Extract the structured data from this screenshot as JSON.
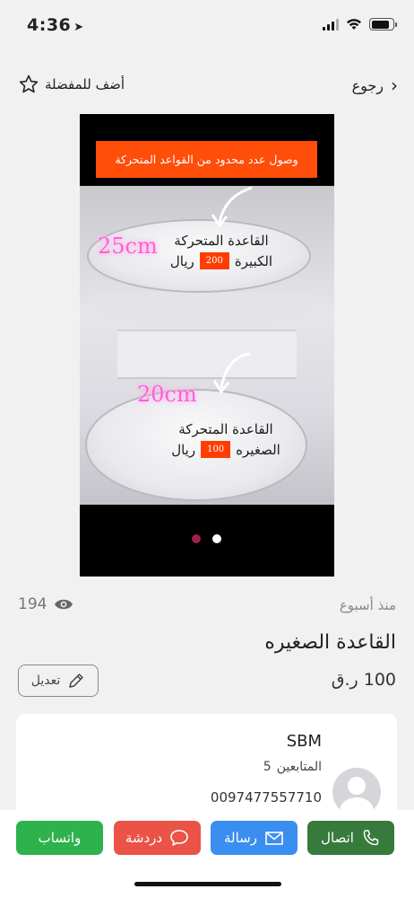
{
  "status_bar": {
    "time": "4:36",
    "location_arrow": "➤",
    "battery_level_percent": 85
  },
  "nav": {
    "back_label": "رجوع",
    "back_chevron": "‹",
    "favorite_label": "أضف للمفضلة"
  },
  "media": {
    "banner_text": "وصول عدد محدود من القواعد المتحركة",
    "big_size": "25cm",
    "big_title": "القاعدة المتحركة",
    "big_prefix": "الكبيرة",
    "big_price": "200",
    "big_currency": "ريال",
    "small_size": "20cm",
    "small_title": "القاعدة المتحركة",
    "small_prefix": "الصغيره",
    "small_price": "100",
    "small_currency": "ريال",
    "active_slide": 1,
    "slide_count": 2,
    "colors": {
      "dot_active": "#a0204f",
      "dot_inactive": "#ffffff",
      "banner": "#ff4d0a"
    }
  },
  "listing": {
    "views": "194",
    "posted": "منذ أسبوع",
    "title": "القاعدة الصغيره",
    "price": "100 ر.ق",
    "edit_label": "تعديل"
  },
  "seller": {
    "name": "SBM",
    "followers_label": "المتابعين",
    "followers_count": "5",
    "phone": "0097477557710"
  },
  "actions": {
    "call": "اتصال",
    "message": "رسالة",
    "chat": "دردشة",
    "whatsapp": "واتساب",
    "colors": {
      "call": "#377a3c",
      "message": "#3a8ef0",
      "chat": "#ea5346",
      "whatsapp": "#2eb24c"
    }
  }
}
